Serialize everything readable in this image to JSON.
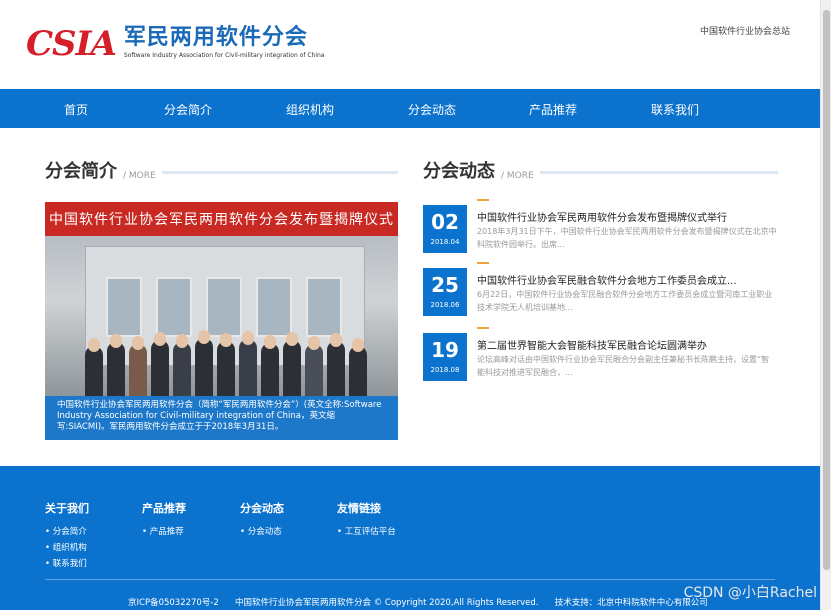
{
  "header": {
    "logo_mark": "CSIA",
    "logo_cn": "军民两用软件分会",
    "logo_en": "Software Industry Association for Civil-military integration of China",
    "top_link": "中国软件行业协会总站"
  },
  "nav": {
    "items": [
      "首页",
      "分会简介",
      "组织机构",
      "分会动态",
      "产品推荐",
      "联系我们"
    ]
  },
  "intro": {
    "title": "分会简介",
    "more": "/ MORE",
    "banner": "中国软件行业协会军民两用软件分会发布暨揭牌仪式",
    "caption": "中国软件行业协会军民两用软件分会（简称“军民两用软件分会”）(英文全称:Software Industry Association for Civil-military integration of China，英文缩写:SIACMI)。军民两用软件分会成立于于2018年3月31日。"
  },
  "news": {
    "title": "分会动态",
    "more": "/ MORE",
    "items": [
      {
        "day": "02",
        "ym": "2018.04",
        "title": "中国软件行业协会军民两用软件分会发布暨揭牌仪式举行",
        "desc": "2018年3月31日下午，中国软件行业协会军民两用软件分会发布暨揭牌仪式在北京中科院软件园举行。出席..."
      },
      {
        "day": "25",
        "ym": "2018.06",
        "title": "中国软件行业协会军民融合软件分会地方工作委员会成立...",
        "desc": "6月22日，中国软件行业协会军民融合软件分会地方工作委员会成立暨河南工业职业技术学院无人机培训基地..."
      },
      {
        "day": "19",
        "ym": "2018.08",
        "title": "第二届世界智能大会智能科技军民融合论坛圆满举办",
        "desc": "论坛高峰对话由中国软件行业协会军民融合分会副主任兼秘书长陈鹏主持，设置“智能科技对推进军民融合，..."
      }
    ]
  },
  "footer": {
    "columns": [
      {
        "title": "关于我们",
        "items": [
          "• 分会简介",
          "• 组织机构",
          "• 联系我们"
        ]
      },
      {
        "title": "产品推荐",
        "items": [
          "• 产品推荐"
        ]
      },
      {
        "title": "分会动态",
        "items": [
          "• 分会动态"
        ]
      },
      {
        "title": "友情链接",
        "items": [
          "• 工互评估平台"
        ]
      }
    ],
    "copyright": "京ICP备05032270号-2      中国软件行业协会军民两用软件分会 © Copyright 2020,All Rights Reserved.      技术支持：北京中科院软件中心有限公司"
  },
  "watermark": "CSDN @小白Rachel",
  "colors": {
    "primary": "#0b72cd",
    "logo_red": "#d5202a",
    "banner_red": "#c82a23",
    "accent": "#f0a23c"
  }
}
